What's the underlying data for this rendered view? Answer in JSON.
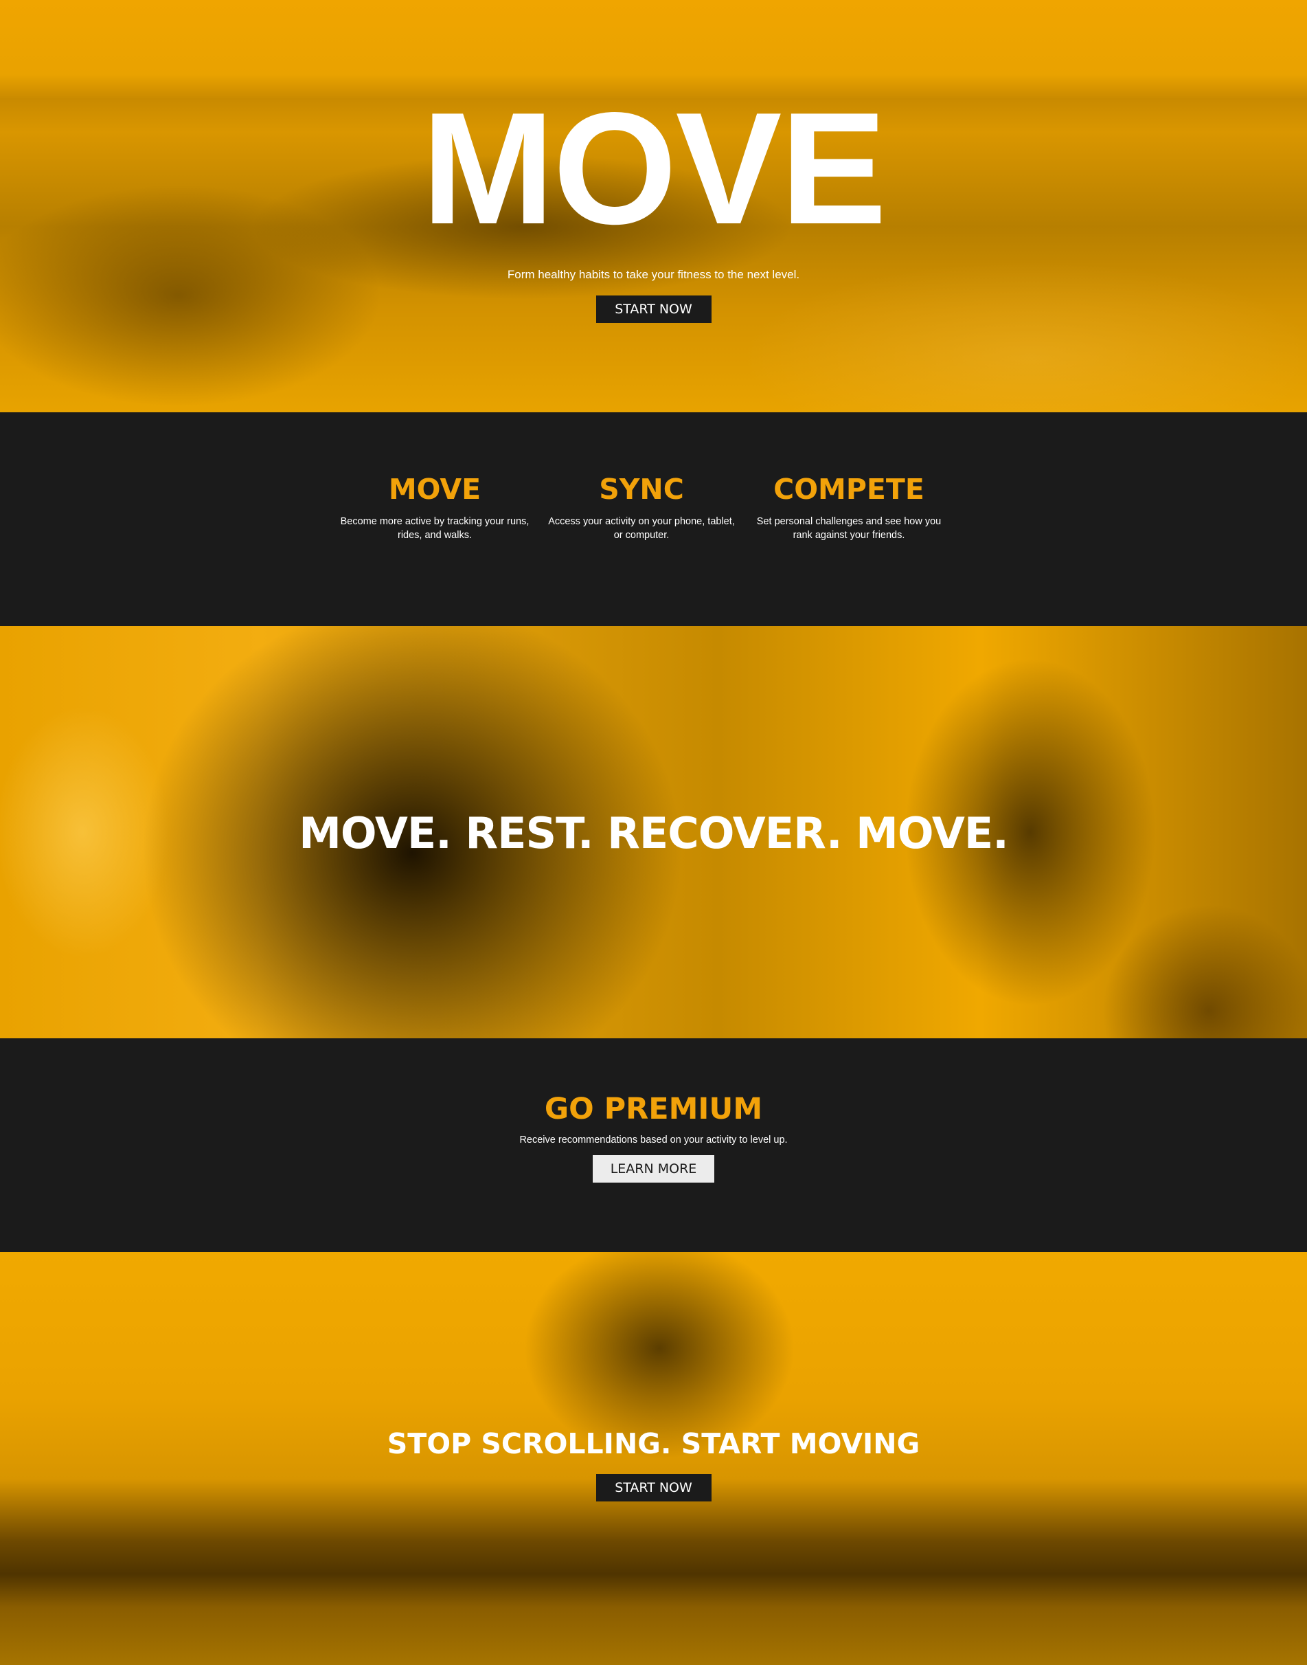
{
  "hero": {
    "title": "MOVE",
    "subtitle": "Form healthy habits to take your fitness to the next level.",
    "button_label": "START NOW"
  },
  "features": [
    {
      "title": "MOVE",
      "description": "Become more active by tracking your runs, rides, and walks."
    },
    {
      "title": "SYNC",
      "description": "Access your activity on your phone, tablet, or computer."
    },
    {
      "title": "COMPETE",
      "description": "Set personal challenges and see how you rank against your friends."
    }
  ],
  "banner": {
    "text": "MOVE. REST. RECOVER. MOVE."
  },
  "premium": {
    "title": "GO PREMIUM",
    "description": "Receive recommendations based on your activity to level up.",
    "button_label": "LEARN MORE"
  },
  "cta": {
    "title": "STOP SCROLLING. START MOVING",
    "button_label": "START NOW"
  },
  "colors": {
    "accent": "#f2a20a",
    "dark": "#1b1b1b",
    "light_button": "#ececec"
  }
}
